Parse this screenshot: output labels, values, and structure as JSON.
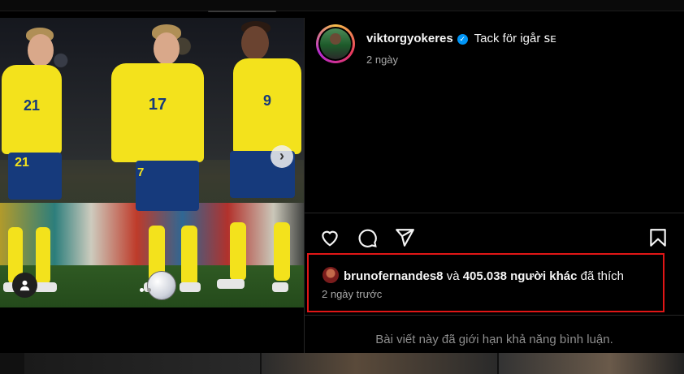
{
  "post": {
    "username": "viktorgyokeres",
    "caption": "Tack för igår 🇸🇪",
    "caption_display": "Tack för igår ꜱᴇ",
    "time_ago": "2 ngày",
    "jersey_numbers": [
      "21",
      "17",
      "9",
      "21",
      "7"
    ]
  },
  "likes": {
    "liker": "brunofernandes8",
    "connector": "và",
    "others": "405.038 người khác",
    "suffix": "đã thích",
    "time_ago": "2 ngày trước"
  },
  "comments": {
    "restricted_text": "Bài viết này đã giới hạn khả năng bình luận."
  },
  "icons": {
    "like": "heart-icon",
    "comment": "comment-icon",
    "share": "share-icon",
    "save": "bookmark-icon",
    "next": "chevron-right-icon",
    "tag": "person-icon",
    "verified": "verified-badge-icon"
  },
  "colors": {
    "highlight_border": "#e01616",
    "verified": "#0095f6",
    "jersey_yellow": "#f3e21c",
    "shorts_blue": "#163a7c"
  }
}
